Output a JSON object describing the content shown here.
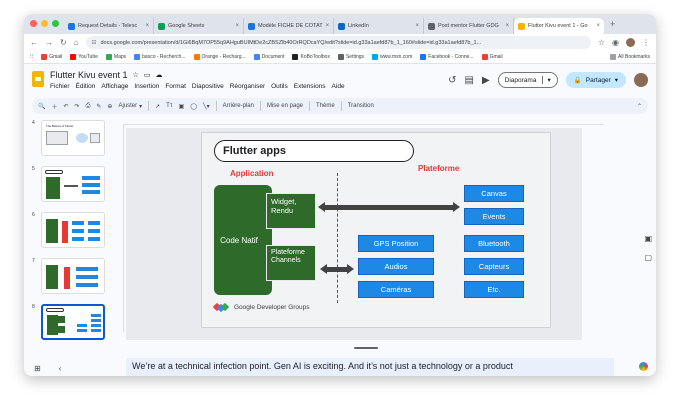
{
  "browser": {
    "tabs": [
      {
        "label": "Request Details - Telesc",
        "color": "#1a73e8"
      },
      {
        "label": "Google Sheets",
        "color": "#0f9d58"
      },
      {
        "label": "Modèle FICHE DE COTAT",
        "color": "#1a73e8"
      },
      {
        "label": "LinkedIn",
        "color": "#0a66c2"
      },
      {
        "label": "Post mentor Flutter GDG",
        "color": "#5f6368"
      },
      {
        "label": "Flutter Kivu event 1 - Go",
        "color": "#f4b400"
      }
    ],
    "new_tab": "+",
    "url": "docs.google.com/presentation/d/1Gi6BqM7OP55q9AHguBUIMtDe2cZBSZlb40OrRQDcaYQ/edit?slide=id.g33a1aefd87b_1_160#slide=id.g33a1aefd87b_1...",
    "bookmarks": [
      {
        "label": "Gmail",
        "color": "#ea4335"
      },
      {
        "label": "YouTube",
        "color": "#ff0000"
      },
      {
        "label": "Maps",
        "color": "#34a853"
      },
      {
        "label": "basco - Recherch...",
        "color": "#4285f4"
      },
      {
        "label": "Orange - Recharg...",
        "color": "#ff7900"
      },
      {
        "label": "Document",
        "color": "#4285f4"
      },
      {
        "label": "KoBoToolbox",
        "color": "#202124"
      },
      {
        "label": "Settings",
        "color": "#5f6368"
      },
      {
        "label": "www.msn.com",
        "color": "#00a4ef"
      },
      {
        "label": "Facebook - Conne...",
        "color": "#1877f2"
      },
      {
        "label": "Gmail",
        "color": "#ea4335"
      }
    ],
    "all_bookmarks": "All Bookmarks"
  },
  "doc": {
    "title": "Flutter Kivu event 1",
    "menu": [
      "Fichier",
      "Édition",
      "Affichage",
      "Insertion",
      "Format",
      "Diapositive",
      "Réorganiser",
      "Outils",
      "Extensions",
      "Aide"
    ],
    "slideshow_label": "Diaporama",
    "share_label": "Partager"
  },
  "toolbar": {
    "zoom_label": "Ajuster",
    "background": "Arrière-plan",
    "layout": "Mise en page",
    "theme": "Thème",
    "transition": "Transition"
  },
  "filmstrip": {
    "numbers": [
      "4",
      "5",
      "6",
      "7",
      "8"
    ],
    "thumb4_title": "The Basics of Flutter"
  },
  "slide": {
    "title": "Flutter apps",
    "application_label": "Application",
    "platform_label": "Plateforme",
    "code_natif": "Code Natif",
    "widget_rendu": "Widget,\nRendu",
    "platform_channels": "Plateforme\nChannels",
    "middle_boxes": [
      "GPS Position",
      "Audios",
      "Caméras"
    ],
    "right_boxes": [
      "Canvas",
      "Events",
      "Bluetooth",
      "Capteurs",
      "Etc."
    ],
    "gdg": "Google Developer Groups"
  },
  "notes": {
    "text": "We’re at a technical infection point. Gen AI is exciting. And it’s not just a technology or a product"
  }
}
